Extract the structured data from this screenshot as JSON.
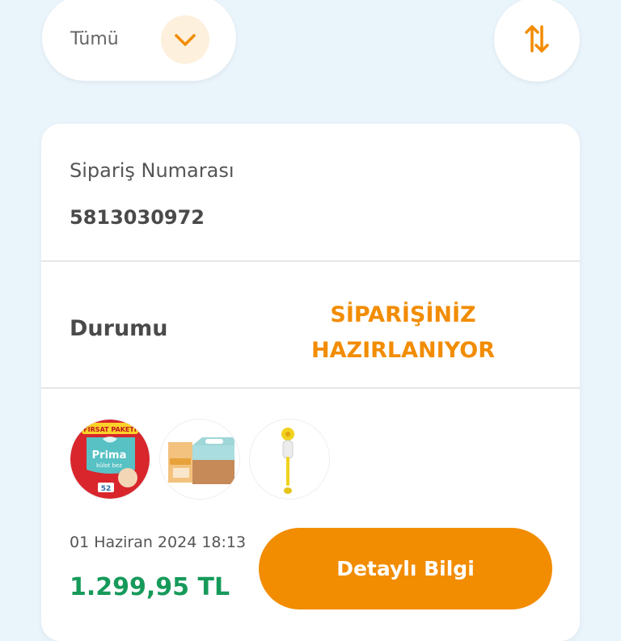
{
  "filter": {
    "label": "Tümü",
    "icon": "chevron-down-icon"
  },
  "sort": {
    "icon": "sort-arrows-icon"
  },
  "order": {
    "number_label": "Sipariş Numarası",
    "number_value": "5813030972",
    "status_label": "Durumu",
    "status_value": "SİPARİŞİNİZ\nHAZIRLANIYOR",
    "products": [
      {
        "name": "product-thumb-diapers",
        "badge_text": "FIRSAT PAKETİ",
        "brand_text": "Prima",
        "sub_text": "külot bez",
        "count_text": "52"
      },
      {
        "name": "product-thumb-wipes-box"
      },
      {
        "name": "product-thumb-bottle-brush"
      }
    ],
    "date": "01 Haziran 2024 18:13",
    "total": "1.299,95 TL",
    "details_button": "Detaylı Bilgi"
  },
  "colors": {
    "accent": "#f28c00",
    "price": "#169a5a",
    "background": "#eaf4fb"
  }
}
